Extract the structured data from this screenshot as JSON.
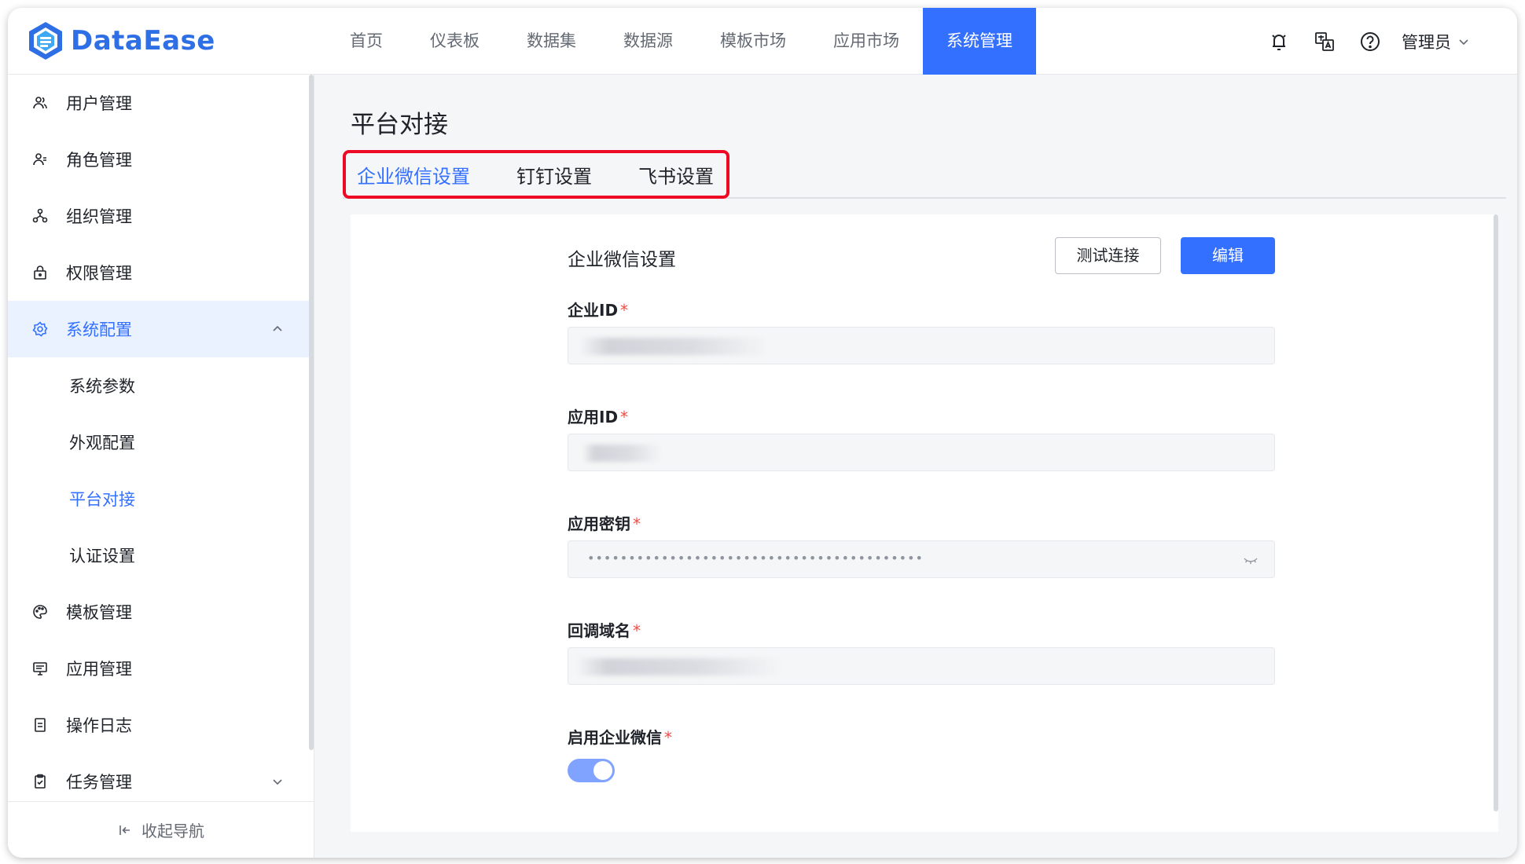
{
  "app": {
    "brand": "DataEase"
  },
  "nav": {
    "items": [
      "首页",
      "仪表板",
      "数据集",
      "数据源",
      "模板市场",
      "应用市场",
      "系统管理"
    ],
    "active": "系统管理"
  },
  "header": {
    "user": "管理员"
  },
  "sidebar": {
    "items": [
      {
        "label": "用户管理",
        "icon": "users-icon"
      },
      {
        "label": "角色管理",
        "icon": "role-icon"
      },
      {
        "label": "组织管理",
        "icon": "org-icon"
      },
      {
        "label": "权限管理",
        "icon": "lock-icon"
      },
      {
        "label": "系统配置",
        "icon": "gear-icon"
      }
    ],
    "sub_items": [
      "系统参数",
      "外观配置",
      "平台对接",
      "认证设置"
    ],
    "active_sub": "平台对接",
    "items_after": [
      {
        "label": "模板管理",
        "icon": "palette-icon"
      },
      {
        "label": "应用管理",
        "icon": "monitor-icon"
      },
      {
        "label": "操作日志",
        "icon": "log-icon"
      },
      {
        "label": "任务管理",
        "icon": "clipboard-icon"
      }
    ],
    "collapse_label": "收起导航"
  },
  "page": {
    "title": "平台对接",
    "tabs": [
      "企业微信设置",
      "钉钉设置",
      "飞书设置"
    ],
    "active_tab": "企业微信设置"
  },
  "form": {
    "title": "企业微信设置",
    "test_button": "测试连接",
    "edit_button": "编辑",
    "fields": [
      {
        "label": "企业ID",
        "type": "masked-text"
      },
      {
        "label": "应用ID",
        "type": "masked-text"
      },
      {
        "label": "应用密钥",
        "type": "password",
        "value": "•••••••••••••••••••••••••••••••••••••••••"
      },
      {
        "label": "回调域名",
        "type": "masked-text"
      }
    ],
    "toggle_label": "启用企业微信",
    "toggle_on": true
  },
  "colors": {
    "primary": "#3370ff",
    "highlight_box": "#ee0a24",
    "required": "#f54a45"
  }
}
